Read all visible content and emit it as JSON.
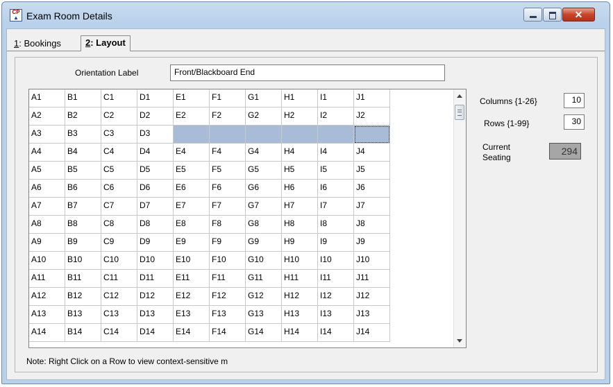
{
  "window": {
    "title": "Exam Room Details"
  },
  "tabs": {
    "bookings_hotkey": "1",
    "bookings_rest": ": Bookings",
    "layout_hotkey": "2",
    "layout_rest": ": Layout"
  },
  "orientation": {
    "label": "Orientation Label",
    "value": "Front/Blackboard End"
  },
  "grid": {
    "rows": [
      [
        "A1",
        "B1",
        "C1",
        "D1",
        "E1",
        "F1",
        "G1",
        "H1",
        "I1",
        "J1"
      ],
      [
        "A2",
        "B2",
        "C2",
        "D2",
        "E2",
        "F2",
        "G2",
        "H2",
        "I2",
        "J2"
      ],
      [
        "A3",
        "B3",
        "C3",
        "D3",
        "",
        "",
        "",
        "",
        "",
        ""
      ],
      [
        "A4",
        "B4",
        "C4",
        "D4",
        "E4",
        "F4",
        "G4",
        "H4",
        "I4",
        "J4"
      ],
      [
        "A5",
        "B5",
        "C5",
        "D5",
        "E5",
        "F5",
        "G5",
        "H5",
        "I5",
        "J5"
      ],
      [
        "A6",
        "B6",
        "C6",
        "D6",
        "E6",
        "F6",
        "G6",
        "H6",
        "I6",
        "J6"
      ],
      [
        "A7",
        "B7",
        "C7",
        "D7",
        "E7",
        "F7",
        "G7",
        "H7",
        "I7",
        "J7"
      ],
      [
        "A8",
        "B8",
        "C8",
        "D8",
        "E8",
        "F8",
        "G8",
        "H8",
        "I8",
        "J8"
      ],
      [
        "A9",
        "B9",
        "C9",
        "D9",
        "E9",
        "F9",
        "G9",
        "H9",
        "I9",
        "J9"
      ],
      [
        "A10",
        "B10",
        "C10",
        "D10",
        "E10",
        "F10",
        "G10",
        "H10",
        "I10",
        "J10"
      ],
      [
        "A11",
        "B11",
        "C11",
        "D11",
        "E11",
        "F11",
        "G11",
        "H11",
        "I11",
        "J11"
      ],
      [
        "A12",
        "B12",
        "C12",
        "D12",
        "E12",
        "F12",
        "G12",
        "H12",
        "I12",
        "J12"
      ],
      [
        "A13",
        "B13",
        "C13",
        "D13",
        "E13",
        "F13",
        "G13",
        "H13",
        "I13",
        "J13"
      ],
      [
        "A14",
        "B14",
        "C14",
        "D14",
        "E14",
        "F14",
        "G14",
        "H14",
        "I14",
        "J14"
      ]
    ],
    "selected_row_index": 2,
    "selected_from_col": 4,
    "focused_col": 9
  },
  "side": {
    "columns_label": "Columns {1-26}",
    "columns_value": "10",
    "rows_label": "Rows  {1-99}",
    "rows_value": "30",
    "seating_label_line1": "Current",
    "seating_label_line2": "Seating",
    "seating_value": "294"
  },
  "note": "Note: Right Click on a Row to view context-sensitive m",
  "colors": {
    "selection": "#a8bcd8",
    "seating_box": "#a6a6a6",
    "close_button": "#c8452a"
  }
}
